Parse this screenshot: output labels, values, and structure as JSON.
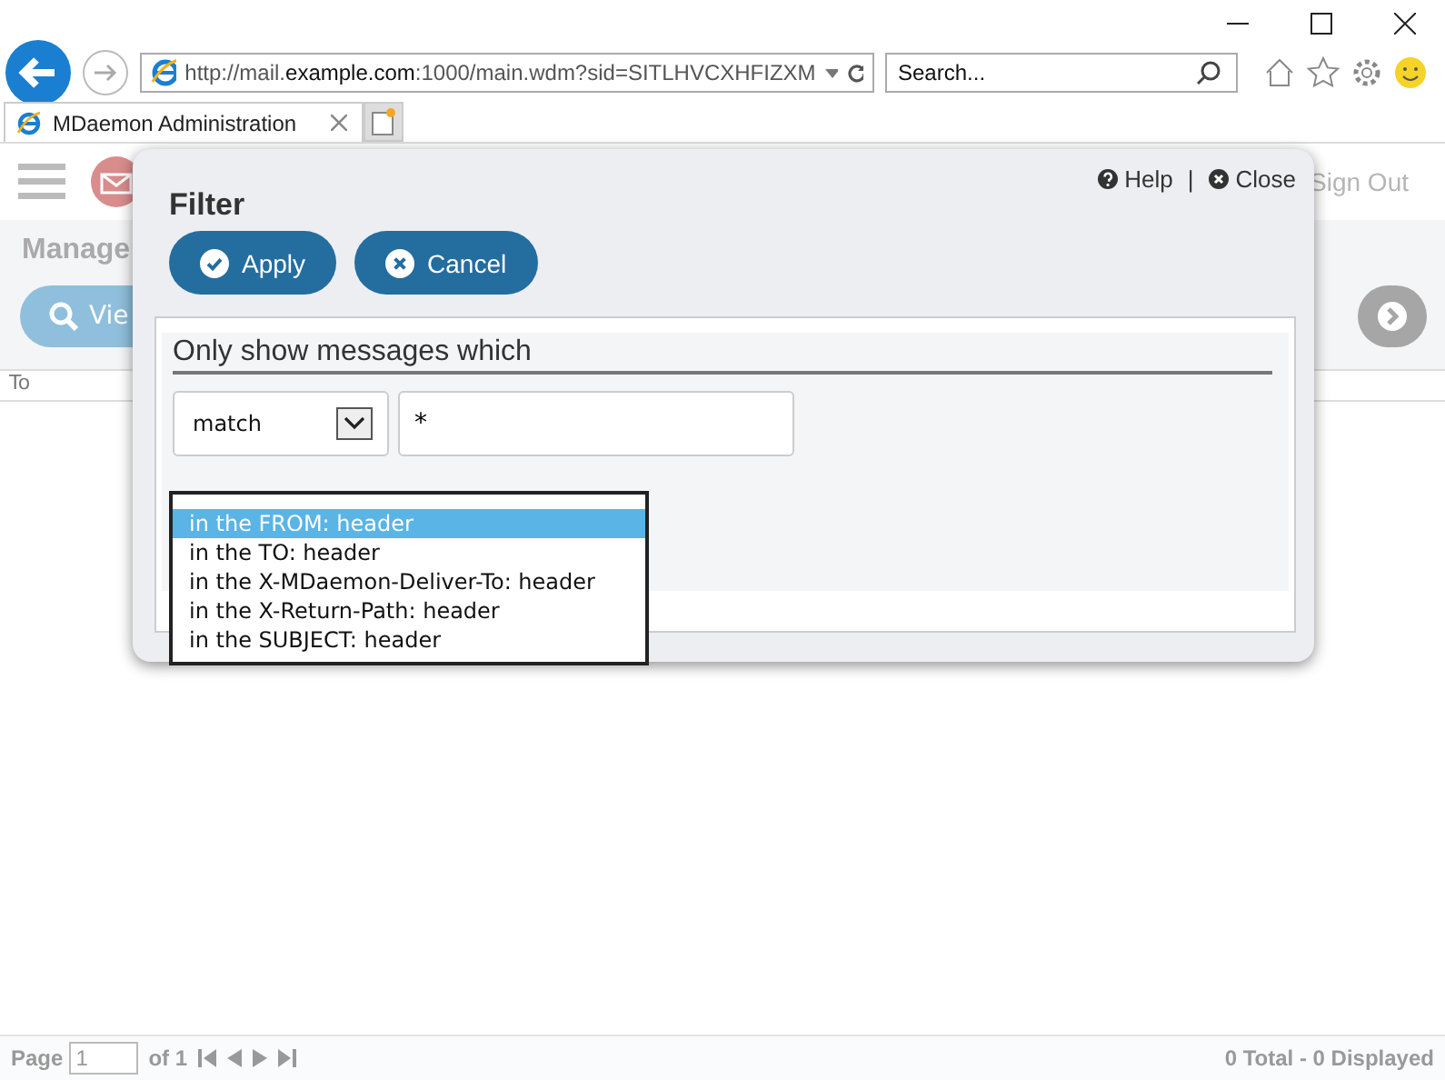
{
  "browser": {
    "url": "http://mail.**example.com**:1000/main.wdm?sid=SITLHVCXHFIZXM",
    "search": {
      "placeholder": "Search..."
    },
    "tabs": [
      {
        "title": "MDaemon Administration",
        "selected": true
      }
    ]
  },
  "app": {
    "sign_out": "Sign Out",
    "page_title": "Manage",
    "view_button": "Vie",
    "columns": [
      "To"
    ]
  },
  "footer": {
    "page_label": "Page",
    "page_value": "1",
    "page_of": "of 1",
    "totals": "0 Total - 0 Displayed"
  },
  "dialog": {
    "title": "Filter",
    "help": "Help",
    "separator": "|",
    "close": "Close",
    "buttons": [
      {
        "label": "Apply",
        "kind": "apply"
      },
      {
        "label": "Cancel",
        "kind": "cancel"
      }
    ],
    "heading": "Only show messages which",
    "condition": {
      "value": "match"
    },
    "pattern": {
      "value": "*"
    },
    "options": [
      {
        "label": "in the FROM: header",
        "selected": true
      },
      {
        "label": "in the TO: header",
        "selected": false
      },
      {
        "label": "in the X-MDaemon-Deliver-To: header",
        "selected": false
      },
      {
        "label": "in the X-Return-Path: header",
        "selected": false
      },
      {
        "label": "in the SUBJECT: header",
        "selected": false
      }
    ]
  }
}
